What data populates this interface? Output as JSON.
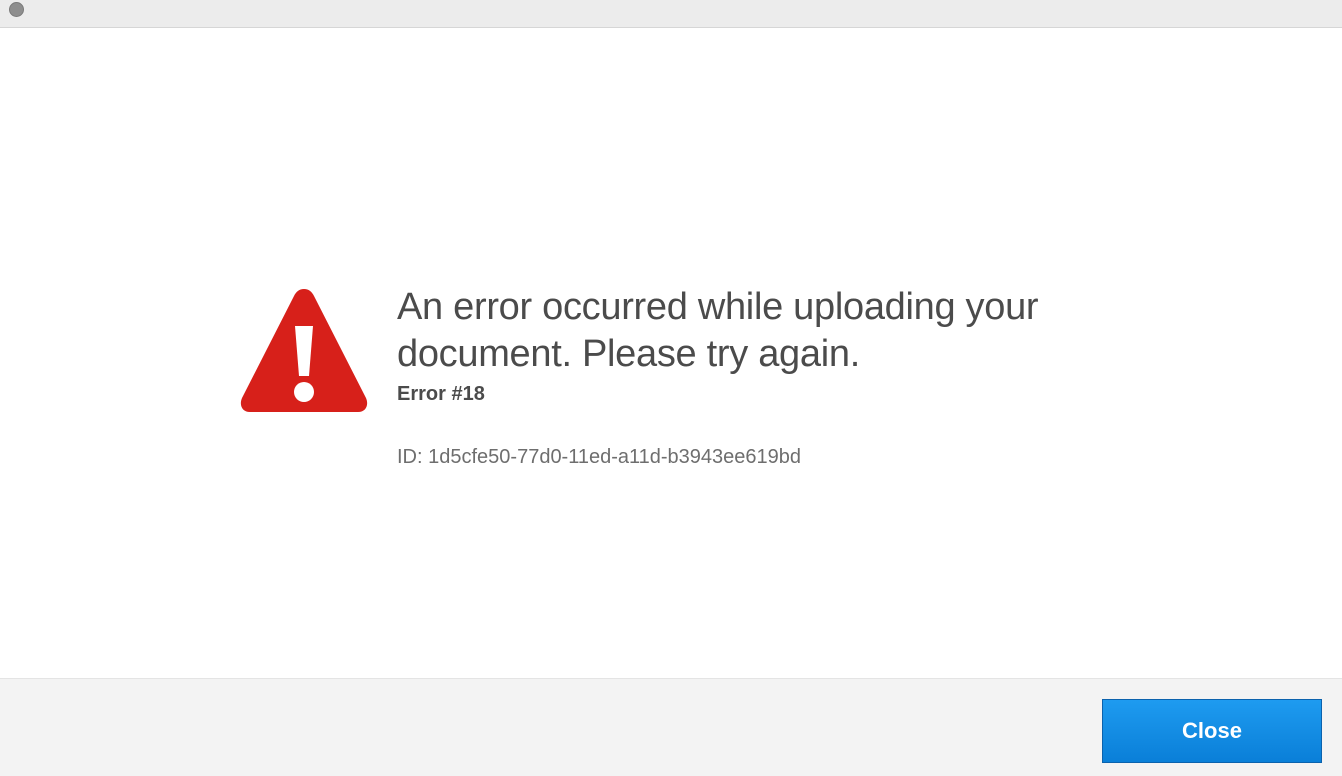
{
  "dialog": {
    "headline": "An error occurred while uploading your document. Please try again.",
    "error_code": "Error #18",
    "error_id": "ID: 1d5cfe50-77d0-11ed-a11d-b3943ee619bd",
    "icon": "warning-icon"
  },
  "footer": {
    "close_label": "Close"
  },
  "colors": {
    "warning_red": "#d7201a",
    "button_blue": "#1589e6",
    "text_dark": "#4b4b4b",
    "text_muted": "#6e6e6e"
  }
}
